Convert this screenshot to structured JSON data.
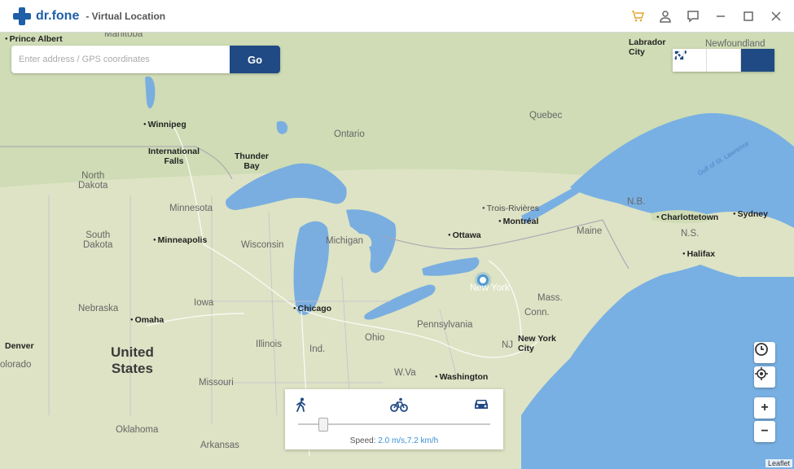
{
  "app": {
    "brand": "dr.fone",
    "subtitle": "- Virtual Location",
    "icons": [
      "cart-icon",
      "user-icon",
      "feedback-icon",
      "minimize-icon",
      "maximize-icon",
      "close-icon"
    ]
  },
  "search": {
    "placeholder": "Enter address / GPS coordinates",
    "value": "",
    "go_label": "Go"
  },
  "modes": [
    {
      "name": "one-stop-route-icon",
      "active": false
    },
    {
      "name": "multi-stop-route-icon",
      "active": false
    },
    {
      "name": "teleport-mode-icon",
      "active": true
    }
  ],
  "map_controls": {
    "history": "history-icon",
    "center": "center-location-icon",
    "zoom_in": "+",
    "zoom_out": "−"
  },
  "speed": {
    "label": "Speed:",
    "value": "2.0 m/s,7.2 km/h",
    "modes": [
      "walking-icon",
      "cycling-icon",
      "driving-icon"
    ],
    "level": 0.12
  },
  "map": {
    "labels": {
      "prince_albert": "Prince Albert",
      "manitoba": "Manitoba",
      "winnipeg": "Winnipeg",
      "international_falls": "International\nFalls",
      "thunder_bay": "Thunder\nBay",
      "ontario": "Ontario",
      "quebec": "Quebec",
      "labrador_city": "Labrador\nCity",
      "newfoundland": "Newfoundland",
      "north_dakota": "North\nDakota",
      "south_dakota": "South\nDakota",
      "minnesota": "Minnesota",
      "minneapolis": "Minneapolis",
      "wisconsin": "Wisconsin",
      "michigan": "Michigan",
      "nebraska": "Nebraska",
      "omaha": "Omaha",
      "iowa": "Iowa",
      "chicago": "Chicago",
      "illinois": "Illinois",
      "ind": "Ind.",
      "ohio": "Ohio",
      "pennsylvania": "Pennsylvania",
      "denver": "Denver",
      "olorado": "olorado",
      "united_states": "United\nStates",
      "missouri": "Missouri",
      "oklahoma": "Oklahoma",
      "arkansas": "Arkansas",
      "wva": "W.Va",
      "washington": "Washington",
      "new_york_city": "New York\nCity",
      "new_york": "New York",
      "ottawa": "Ottawa",
      "montreal": "Montréal",
      "trois_rivieres": "Trois-Rivières",
      "maine": "Maine",
      "nb": "N.B.",
      "ns": "N.S.",
      "charlottetown": "Charlottetown",
      "halifax": "Halifax",
      "sydney": "Sydney",
      "mass": "Mass.",
      "conn": "Conn.",
      "nj": "NJ",
      "gulf": "Gulf of St. Lawrence"
    },
    "attribution": "Leaflet"
  }
}
